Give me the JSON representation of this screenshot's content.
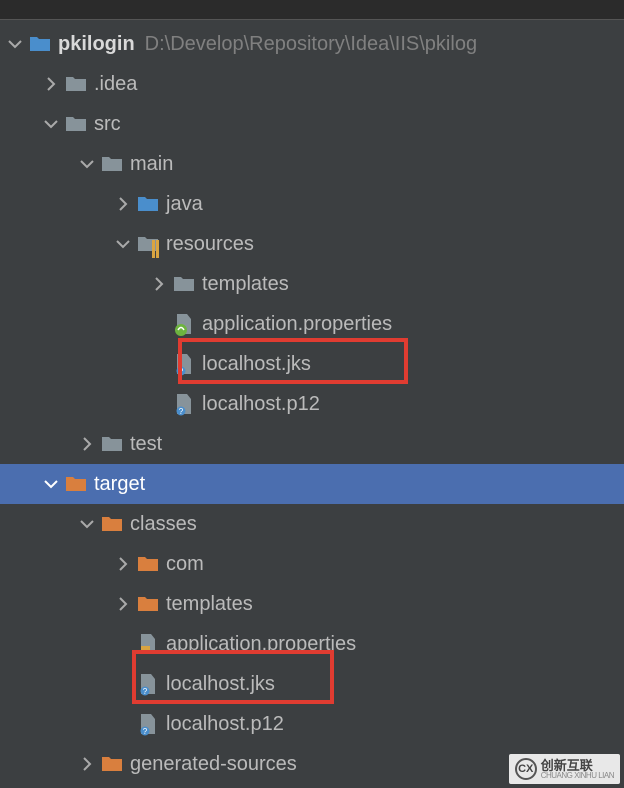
{
  "topBar": {},
  "project": {
    "name": "pkilogin",
    "path": "D:\\Develop\\Repository\\Idea\\IIS\\pkilog"
  },
  "tree": {
    "idea": ".idea",
    "src": "src",
    "main": "main",
    "java": "java",
    "resources": "resources",
    "templates": "templates",
    "app_props": "application.properties",
    "localhost_jks": "localhost.jks",
    "localhost_p12": "localhost.p12",
    "test": "test",
    "target": "target",
    "classes": "classes",
    "com": "com",
    "templates2": "templates",
    "app_props2": "application.properties",
    "localhost_jks2": "localhost.jks",
    "localhost_p122": "localhost.p12",
    "generated_sources": "generated-sources"
  },
  "watermark": {
    "logo": "CX",
    "cn": "创新互联",
    "en": "CHUANG XINHU LIAN"
  }
}
